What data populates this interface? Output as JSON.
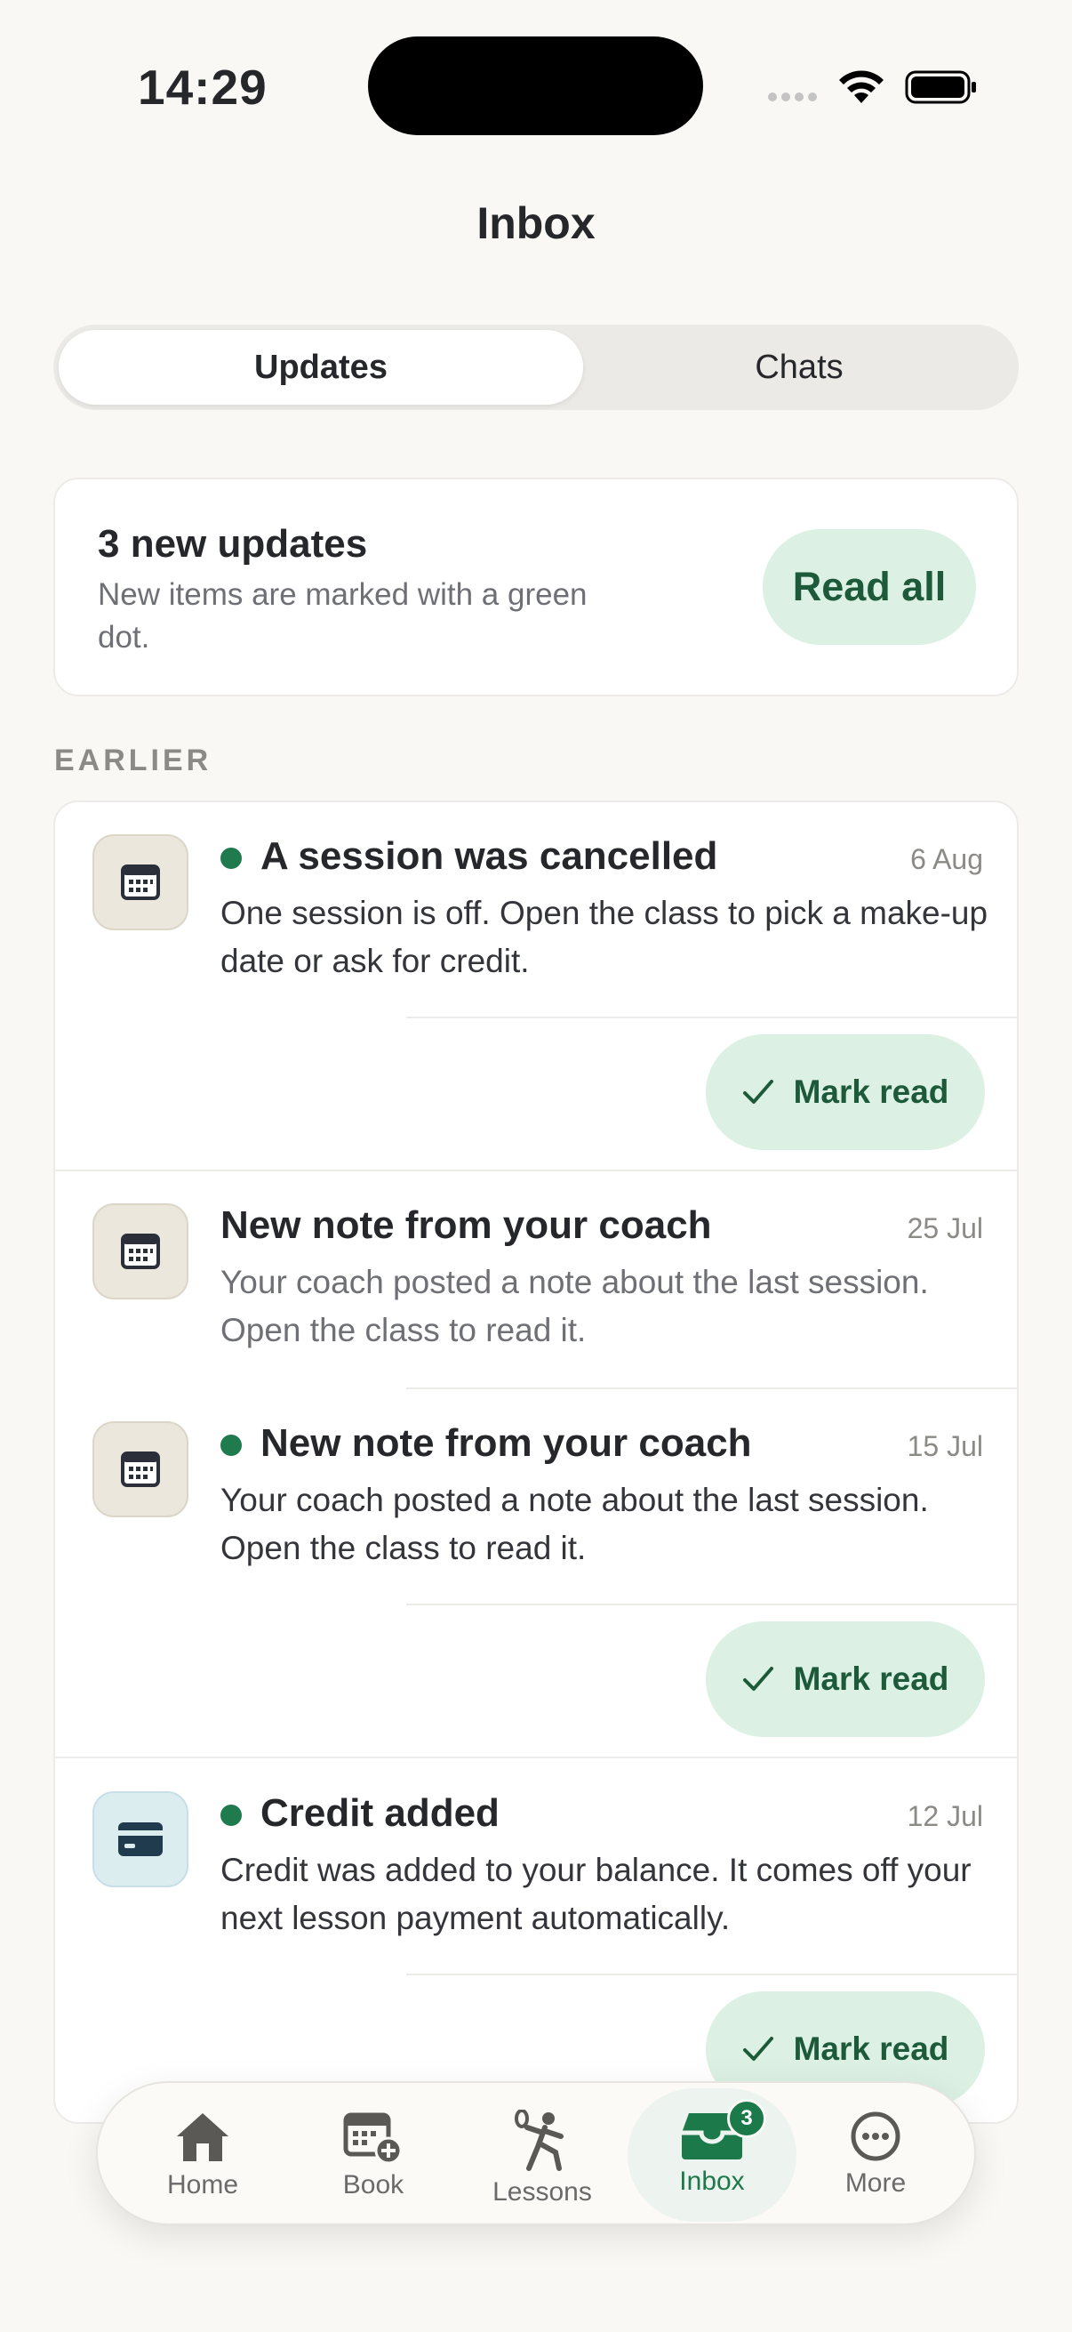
{
  "status_bar": {
    "time": "14:29"
  },
  "page_title": "Inbox",
  "tabs": {
    "updates": "Updates",
    "chats": "Chats",
    "active": "Updates"
  },
  "summary": {
    "title": "3 new updates",
    "subtitle": "New items are marked with a green dot.",
    "read_all_label": "Read all"
  },
  "section_label": "EARLIER",
  "items": [
    {
      "icon": "calendar-icon",
      "unread": true,
      "title": "A session was cancelled",
      "date": "6 Aug",
      "body": "One session is off. Open the class to pick a make-up date or ask for credit.",
      "action": "Mark read"
    },
    {
      "icon": "calendar-icon",
      "unread": false,
      "title": "New note from your coach",
      "date": "25 Jul",
      "body": "Your coach posted a note about the last session. Open the class to read it."
    },
    {
      "icon": "calendar-icon",
      "unread": true,
      "title": "New note from your coach",
      "date": "15 Jul",
      "body": "Your coach posted a note about the last session. Open the class to read it.",
      "action": "Mark read"
    },
    {
      "icon": "credit-card-icon",
      "unread": true,
      "title": "Credit added",
      "date": "12 Jul",
      "body": "Credit was added to your balance. It comes off your next lesson payment automatically.",
      "action": "Mark read"
    }
  ],
  "tab_bar": {
    "items": [
      {
        "label": "Home",
        "icon": "home-icon"
      },
      {
        "label": "Book",
        "icon": "calendar-add-icon"
      },
      {
        "label": "Lessons",
        "icon": "tennis-player-icon"
      },
      {
        "label": "Inbox",
        "icon": "inbox-icon",
        "badge": "3",
        "active": true
      },
      {
        "label": "More",
        "icon": "more-icon"
      }
    ]
  },
  "colors": {
    "accent": "#1f7a4d",
    "accent_bg": "#dcf0e3",
    "background": "#f9f8f5"
  }
}
